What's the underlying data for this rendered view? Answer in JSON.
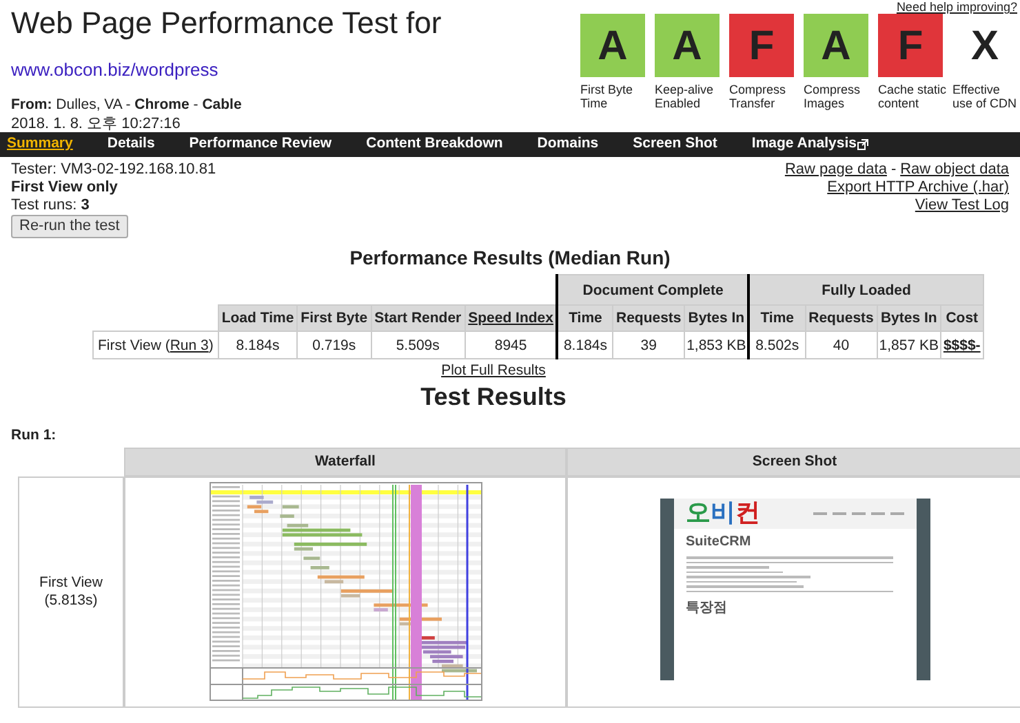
{
  "header": {
    "title": "Web Page Performance Test for",
    "url": "www.obcon.biz/wordpress",
    "from": "**From:** Dulles, VA - **Chrome** - **Cable**",
    "date": "2018. 1. 8. 오후 10:27:16",
    "help_link": "Need help improving?"
  },
  "grades": [
    {
      "grade": "A",
      "label": "First Byte Time",
      "color": "#8fcc52"
    },
    {
      "grade": "A",
      "label": "Keep-alive Enabled",
      "color": "#8fcc52"
    },
    {
      "grade": "F",
      "label": "Compress Transfer",
      "color": "#e0353a"
    },
    {
      "grade": "A",
      "label": "Compress Images",
      "color": "#8fcc52"
    },
    {
      "grade": "F",
      "label": "Cache static content",
      "color": "#e0353a"
    },
    {
      "grade": "X",
      "label": "Effective use of CDN"
    }
  ],
  "nav": [
    {
      "label": "Summary",
      "selected": true,
      "external": false
    },
    {
      "label": "Details",
      "selected": false,
      "external": false
    },
    {
      "label": "Performance Review",
      "selected": false,
      "external": false
    },
    {
      "label": "Content Breakdown",
      "selected": false,
      "external": false
    },
    {
      "label": "Domains",
      "selected": false,
      "external": false
    },
    {
      "label": "Screen Shot",
      "selected": false,
      "external": false
    },
    {
      "label": "Image Analysis",
      "selected": false,
      "external": true
    }
  ],
  "test_info": {
    "tester": "Tester: VM3-02-192.168.10.81",
    "view": "First View only",
    "runs": "Test runs: **3**",
    "rerun_button": "Re-run the test"
  },
  "data_links": [
    {
      "links": [
        "Raw page data",
        "Raw object data"
      ],
      "separator": "-"
    },
    {
      "links": [
        "Export HTTP Archive (.har)"
      ]
    },
    {
      "links": [
        "View Test Log"
      ]
    }
  ],
  "performance": {
    "title": "Performance Results (Median Run)",
    "groups": [
      "Document Complete",
      "Fully Loaded"
    ],
    "columns": [
      {
        "label": "Load Time",
        "link": false
      },
      {
        "label": "First Byte",
        "link": false
      },
      {
        "label": "Start Render",
        "link": false
      },
      {
        "label": "Speed Index",
        "link": true
      },
      {
        "label": "Time",
        "link": false
      },
      {
        "label": "Requests",
        "link": false
      },
      {
        "label": "Bytes In",
        "link": false
      },
      {
        "label": "Time",
        "link": false
      },
      {
        "label": "Requests",
        "link": false
      },
      {
        "label": "Bytes In",
        "link": false
      },
      {
        "label": "Cost",
        "link": false
      }
    ],
    "row": {
      "label_prefix": "First View (",
      "run_link": "Run 3",
      "label_suffix": ")",
      "cells": [
        {
          "text": "8.184s",
          "link": false
        },
        {
          "text": "0.719s",
          "link": false
        },
        {
          "text": "5.509s",
          "link": false
        },
        {
          "text": "8945",
          "link": false
        },
        {
          "text": "8.184s",
          "link": false
        },
        {
          "text": "39",
          "link": false
        },
        {
          "text": "1,853 KB",
          "link": false
        },
        {
          "text": "8.502s",
          "link": false
        },
        {
          "text": "40",
          "link": false
        },
        {
          "text": "1,857 KB",
          "link": false
        },
        {
          "text": "$$$$-",
          "link": true
        }
      ]
    },
    "plot_link": "Plot Full Results"
  },
  "test_results": {
    "title": "Test Results",
    "run_label": "Run 1:",
    "columns": [
      "Waterfall",
      "Screen Shot"
    ],
    "row_label": "First View",
    "row_time": "(5.813s)",
    "screenshot": {
      "logo": "오비컨",
      "heading": "SuiteCRM",
      "subheading": "특장점"
    }
  }
}
